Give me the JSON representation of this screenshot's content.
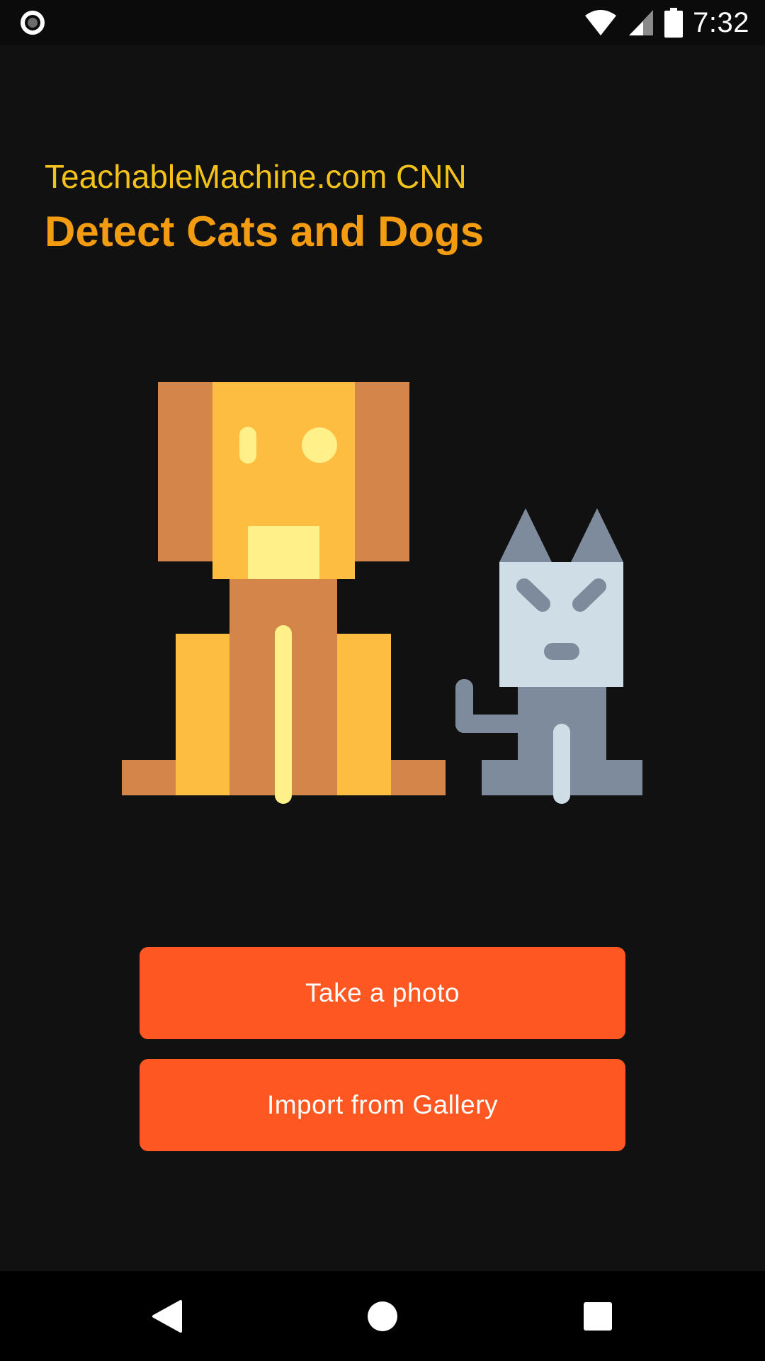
{
  "status_bar": {
    "time": "7:32",
    "left_icon": "record-icon",
    "icons": [
      "wifi-icon",
      "signal-icon",
      "battery-icon"
    ]
  },
  "header": {
    "subtitle": "TeachableMachine.com CNN",
    "title": "Detect Cats and Dogs"
  },
  "illustration": {
    "icon": "dog-and-cat-illustration"
  },
  "buttons": {
    "take_photo": "Take a photo",
    "import_gallery": "Import from Gallery"
  },
  "nav_bar": {
    "icons": [
      "back-icon",
      "home-icon",
      "recents-icon"
    ]
  },
  "colors": {
    "background": "#111111",
    "subtitle": "#f2c21b",
    "title": "#f39c12",
    "button": "#ff5722",
    "button_text": "#ffffff"
  }
}
